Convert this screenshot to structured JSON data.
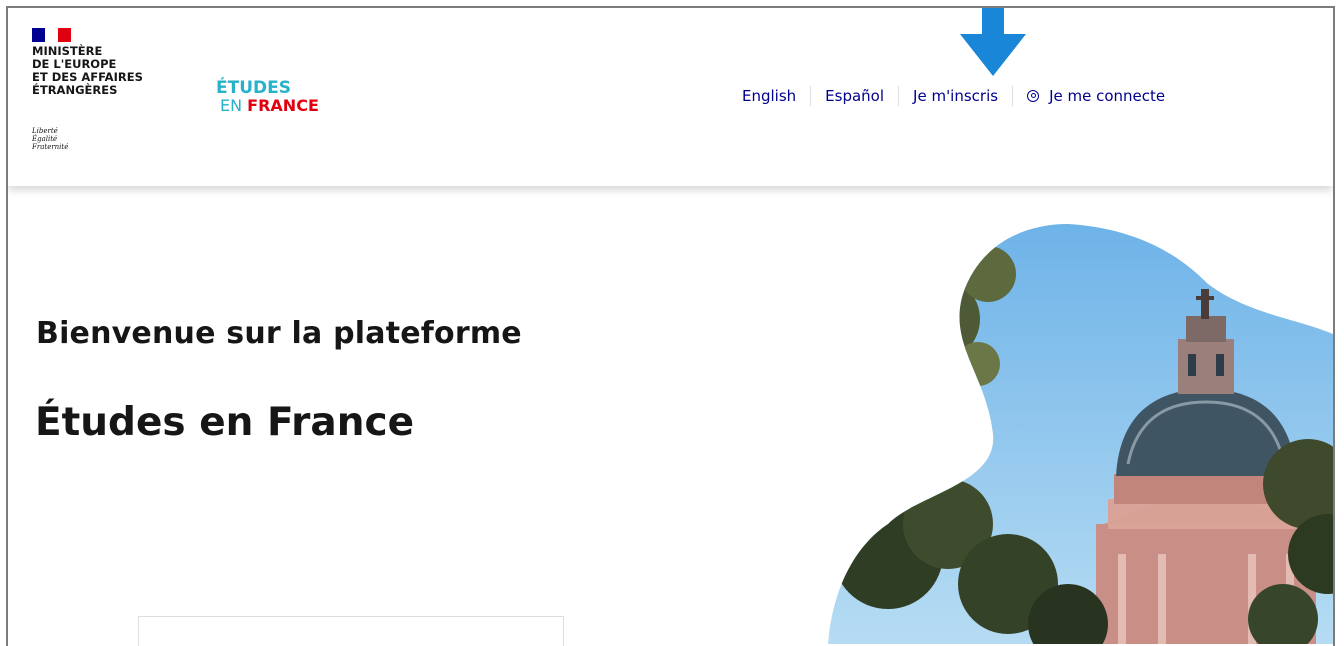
{
  "header": {
    "ministry_name": "MINISTÈRE\nDE L'EUROPE\nET DES AFFAIRES\nÉTRANGÈRES",
    "motto": "Liberté\nÉgalité\nFraternité",
    "brand": {
      "line1": "ÉTUDES",
      "line2_part1": "EN ",
      "line2_part2": "FRANCE"
    },
    "nav": [
      {
        "label": "English"
      },
      {
        "label": "Español"
      },
      {
        "label": "Je m'inscris"
      },
      {
        "label": "Je me connecte",
        "icon": "user-circle-icon"
      }
    ]
  },
  "hero": {
    "subtitle": "Bienvenue sur la plateforme",
    "title": "Études en France"
  },
  "colors": {
    "nav_link": "#00008f",
    "brand_teal": "#27b2c9",
    "brand_red": "#e1000f",
    "marianne_blue": "#000091",
    "annotation_arrow": "#1a86d8",
    "sky": "#8ec5ec"
  }
}
